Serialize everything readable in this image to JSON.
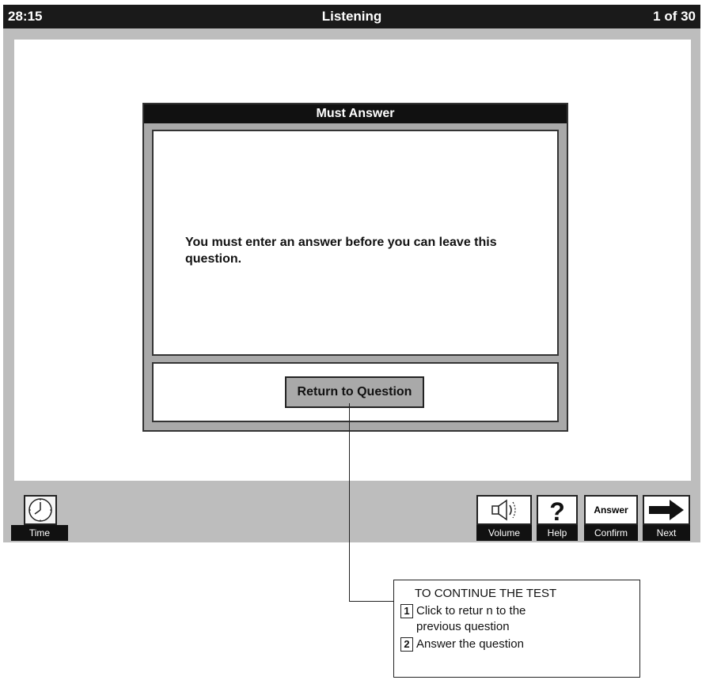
{
  "titlebar": {
    "timer": "28:15",
    "section": "Listening",
    "progress": "1 of 30"
  },
  "dialog": {
    "title": "Must Answer",
    "message": "You must enter an answer before you can leave this question.",
    "return_button": "Return to Question"
  },
  "toolbar": {
    "time_label": "Time",
    "volume_label": "Volume",
    "help_label": "Help",
    "answer_top": "Answer",
    "confirm_label": "Confirm",
    "next_label": "Next"
  },
  "callout": {
    "heading": "TO CONTINUE THE TEST",
    "step1_num": "1",
    "step1_line1": "Click to retur n to the",
    "step1_line2": "previous question",
    "step2_num": "2",
    "step2_text": "Answer the question"
  },
  "icons": {
    "time": "clock-icon",
    "volume": "speaker-icon",
    "help": "question-mark-icon",
    "next": "right-arrow-icon"
  }
}
